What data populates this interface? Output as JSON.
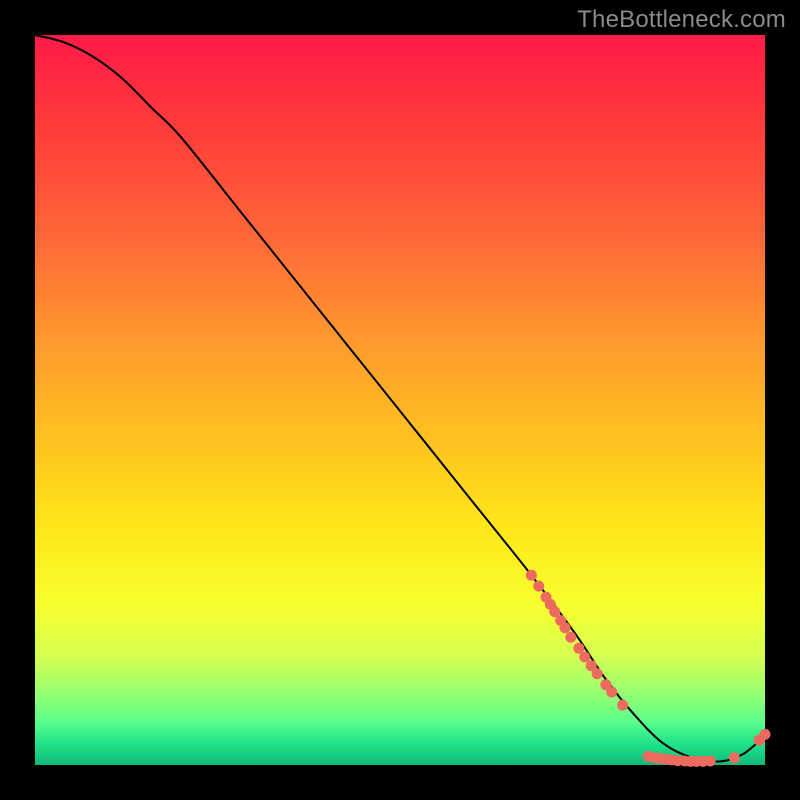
{
  "watermark": "TheBottleneck.com",
  "colors": {
    "background": "#000000",
    "curve_stroke": "#000000",
    "point_fill": "#ec6a5e",
    "watermark": "#8a8a8a"
  },
  "chart_data": {
    "type": "line",
    "title": "",
    "xlabel": "",
    "ylabel": "",
    "xlim": [
      0,
      100
    ],
    "ylim": [
      0,
      100
    ],
    "grid": false,
    "legend": false,
    "series": [
      {
        "name": "curve",
        "x": [
          0,
          4,
          8,
          12,
          16,
          20,
          28,
          36,
          44,
          52,
          60,
          68,
          74,
          78,
          82,
          86,
          90,
          94,
          97,
          100
        ],
        "y": [
          100,
          99,
          97,
          94,
          90,
          86,
          76,
          66,
          56,
          46,
          36,
          26,
          18,
          12,
          7,
          3,
          1,
          0.5,
          1.5,
          4
        ]
      }
    ],
    "points": [
      {
        "x": 68,
        "y": 26
      },
      {
        "x": 69,
        "y": 24.5
      },
      {
        "x": 70,
        "y": 23
      },
      {
        "x": 70.6,
        "y": 22
      },
      {
        "x": 71.2,
        "y": 21
      },
      {
        "x": 72,
        "y": 19.8
      },
      {
        "x": 72.6,
        "y": 18.8
      },
      {
        "x": 73.4,
        "y": 17.5
      },
      {
        "x": 74.5,
        "y": 16
      },
      {
        "x": 75.3,
        "y": 14.8
      },
      {
        "x": 76.2,
        "y": 13.6
      },
      {
        "x": 77.0,
        "y": 12.5
      },
      {
        "x": 78.2,
        "y": 11
      },
      {
        "x": 79.0,
        "y": 10
      },
      {
        "x": 80.5,
        "y": 8.2
      },
      {
        "x": 84.0,
        "y": 1.2
      },
      {
        "x": 84.8,
        "y": 1.0
      },
      {
        "x": 85.6,
        "y": 0.9
      },
      {
        "x": 86.4,
        "y": 0.8
      },
      {
        "x": 87.2,
        "y": 0.7
      },
      {
        "x": 88.0,
        "y": 0.6
      },
      {
        "x": 89.0,
        "y": 0.55
      },
      {
        "x": 89.8,
        "y": 0.5
      },
      {
        "x": 90.6,
        "y": 0.5
      },
      {
        "x": 91.5,
        "y": 0.5
      },
      {
        "x": 92.5,
        "y": 0.55
      },
      {
        "x": 95.8,
        "y": 1.0
      },
      {
        "x": 99.2,
        "y": 3.4
      },
      {
        "x": 100,
        "y": 4.2
      }
    ]
  }
}
